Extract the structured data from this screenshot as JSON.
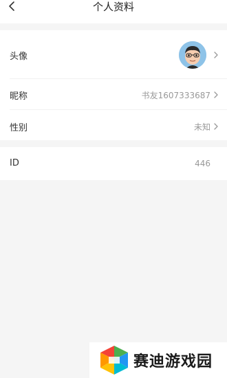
{
  "header": {
    "title": "个人资料"
  },
  "profile": {
    "avatar_label": "头像",
    "nickname_label": "昵称",
    "nickname_value": "书友1607333687",
    "gender_label": "性别",
    "gender_value": "未知"
  },
  "account": {
    "id_label": "ID",
    "id_value": "446"
  },
  "watermark": {
    "text": "赛迪游戏园"
  }
}
